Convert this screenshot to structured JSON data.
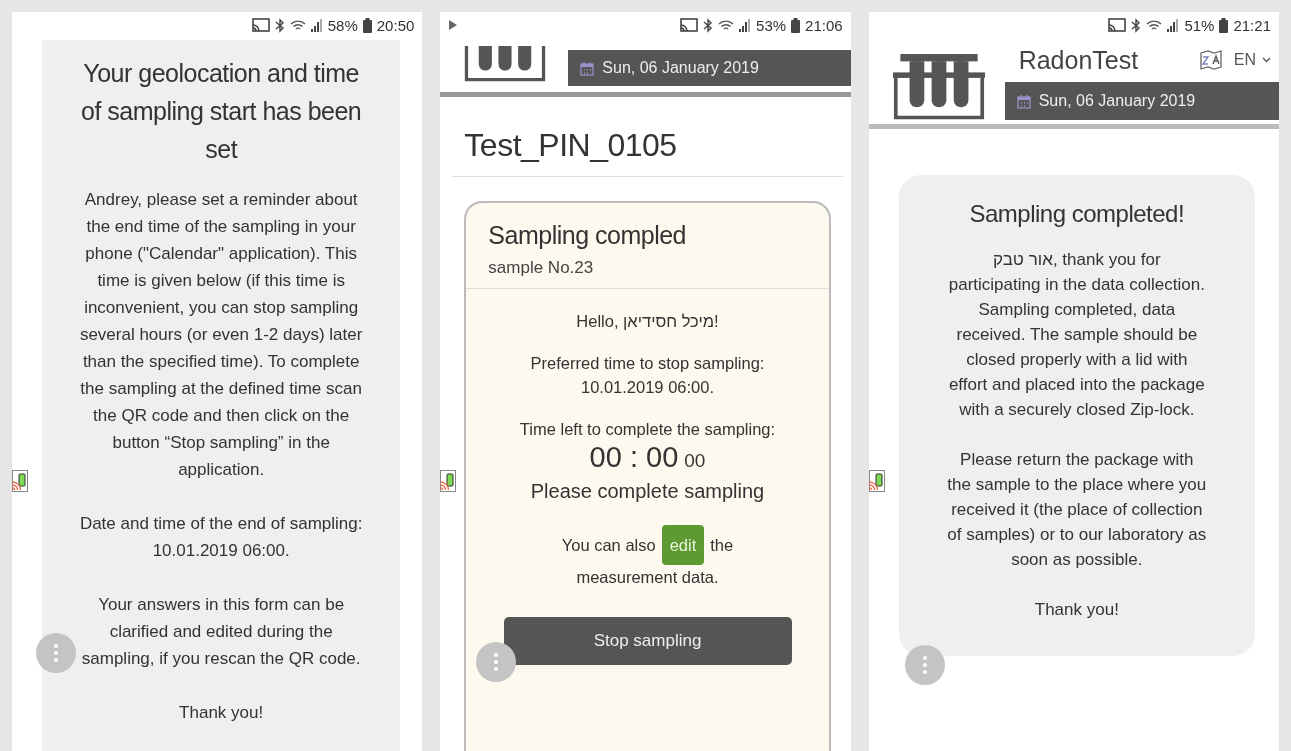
{
  "screens": [
    {
      "kind": "notice",
      "status_bar": {
        "notification_icon": false,
        "battery": "58%",
        "time": "20:50"
      },
      "heading": "Your geolocation and time of sampling start has been set",
      "paragraphs": [
        "Andrey, please set a reminder about the end time of the sampling in your phone (\"Calendar\" application). This time is given below (if this time is inconvenient, you can stop sampling several hours (or even 1-2 days) later than the specified time). To complete the sampling at the defined time scan the QR code and then click on the button “Stop sampling” in the application.",
        "Date and time of the end of sampling: 10.01.2019 06:00.",
        "Your answers in this form can be clarified and edited during the sampling, if you rescan the QR code.",
        "Thank you!"
      ]
    },
    {
      "kind": "sampling",
      "status_bar": {
        "notification_icon": true,
        "battery": "53%",
        "time": "21:06"
      },
      "header": {
        "date": "Sun, 06 January 2019"
      },
      "title": "Test_PIN_0105",
      "card": {
        "title": "Sampling compled",
        "subtitle": "sample No.23",
        "greeting": "Hello, מיכל חסידיאן!",
        "preferred": "Preferred time to stop sampling: 10.01.2019 06:00.",
        "time_left_label": "Time left to complete the sampling:",
        "timer": "00 : 00",
        "timer_fraction": "00",
        "status": "Please complete sampling",
        "edit_before": "You can also",
        "edit_button": "edit",
        "edit_after": "the",
        "edit_line2": "measurement data.",
        "stop_button": "Stop sampling"
      }
    },
    {
      "kind": "completed",
      "status_bar": {
        "notification_icon": false,
        "battery": "51%",
        "time": "21:21"
      },
      "header": {
        "app_name": "RadonTest",
        "language": "EN",
        "date": "Sun, 06 January 2019"
      },
      "heading": "Sampling completed!",
      "paragraphs": [
        "אור טבק, thank you for participating in the data collection. Sampling completed, data received. The sample should be closed properly with a lid with effort and placed into the package with a securely closed Zip-lock.",
        "Please return the package with the sample to the place where you received it (the place of collection of samples) or to our laboratory as soon as possible.",
        "Thank you!"
      ]
    }
  ]
}
